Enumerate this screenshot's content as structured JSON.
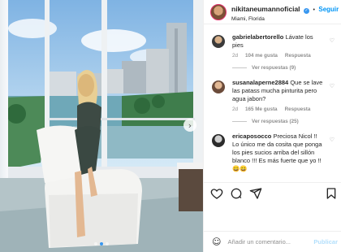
{
  "post": {
    "username": "nikitaneumannoficial",
    "separator": "•",
    "follow_label": "Seguir",
    "location": "Miami, Florida",
    "photo": {
      "next_arrow": "›",
      "slides_total": 3,
      "slide_active": 2
    }
  },
  "comments": [
    {
      "username": "gabrielabertorello",
      "text": "Lávate los pies",
      "time": "2d",
      "likes": "104 me gusta",
      "reply_label": "Respuesta",
      "view_replies": "Ver respuestas (9)",
      "avatar_color": "#3a3a3a"
    },
    {
      "username": "susanalaperne2884",
      "text": "Que se lave las patass mucha pinturita pero agua jabon?",
      "time": "2d",
      "likes": "165 Me gusta",
      "reply_label": "Respuesta",
      "view_replies": "Ver respuestas (25)",
      "avatar_color": "#6b4b3a"
    },
    {
      "username": "ericaposocco",
      "text": "Preciosa Nicol !! Lo único me da cosita que ponga los pies sucios arriba del sillón blanco !!! Es más fuerte que yo !! 😄😄",
      "time": "2d",
      "likes": "",
      "reply_label": "Respuesta",
      "view_replies": "",
      "avatar_color": "#2b2b2b"
    }
  ],
  "actions": {
    "like_icon": "heart-icon",
    "comment_icon": "comment-icon",
    "share_icon": "share-icon",
    "save_icon": "bookmark-icon",
    "small_like_glyph": "♡"
  },
  "add_comment": {
    "emoji_glyph": "☺",
    "placeholder": "Añadir un comentario...",
    "publish_label": "Publicar"
  },
  "colors": {
    "link_blue": "#0095f6",
    "verified_blue": "#3897f0",
    "muted_text": "#8e8e8e",
    "border": "#efefef"
  }
}
